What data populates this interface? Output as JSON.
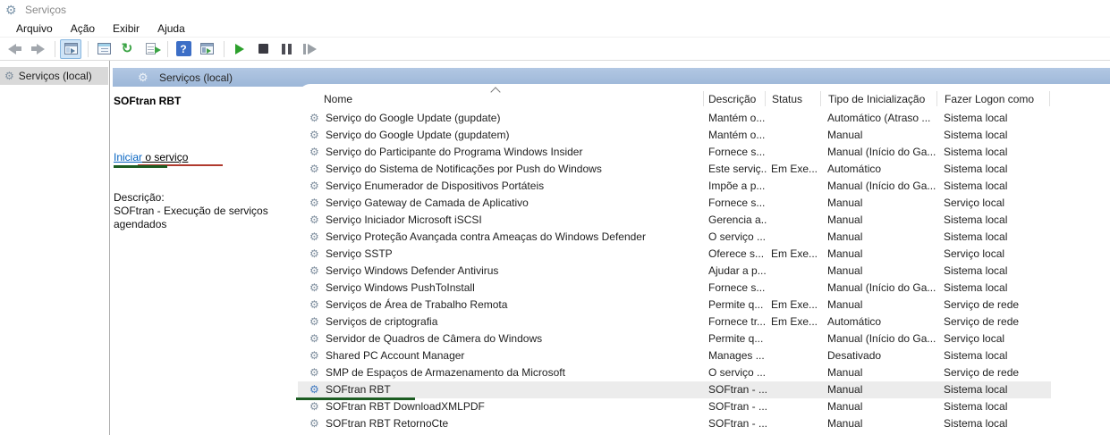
{
  "window": {
    "title": "Serviços",
    "app_icon": "services-gear-icon"
  },
  "menu": {
    "items": [
      {
        "label": "Arquivo"
      },
      {
        "label": "Ação"
      },
      {
        "label": "Exibir"
      },
      {
        "label": "Ajuda"
      }
    ]
  },
  "toolbar": {
    "icons": [
      "back-icon",
      "forward-icon",
      "show-console-tree-icon",
      "properties-icon",
      "refresh-icon",
      "export-list-icon",
      "help-icon",
      "extended-view-icon",
      "start-service-icon",
      "stop-service-icon",
      "pause-service-icon",
      "restart-service-icon"
    ],
    "active_toggle": "show-console-tree-icon",
    "accent_colors": {
      "play_green": "#2ca02c",
      "help_blue": "#3c6ec6",
      "refresh_green": "#3aa344"
    }
  },
  "tree": {
    "root_label": "Serviços (local)"
  },
  "content": {
    "header_label": "Serviços (local)",
    "detail_panel": {
      "service_name": "SOFtran RBT",
      "action_link_part1": "Iniciar",
      "action_link_part2": " o serviço",
      "description_label": "Descrição:",
      "description_text": "SOFtran - Execução de serviços agendados"
    },
    "annotations": {
      "link_green_underline": "#1c5c22",
      "link_red_underline": "#b03a2e",
      "selected_row_green_underline": "#1c5c22"
    },
    "table": {
      "columns": [
        "Nome",
        "Descrição",
        "Status",
        "Tipo de Inicialização",
        "Fazer Logon como"
      ],
      "sort": {
        "column": "Nome",
        "direction": "asc"
      },
      "rows": [
        {
          "name": "Serviço do Google Update (gupdate)",
          "desc": "Mantém o...",
          "status": "",
          "type": "Automático (Atraso ...",
          "logon": "Sistema local",
          "selected": false
        },
        {
          "name": "Serviço do Google Update (gupdatem)",
          "desc": "Mantém o...",
          "status": "",
          "type": "Manual",
          "logon": "Sistema local",
          "selected": false
        },
        {
          "name": "Serviço do Participante do Programa Windows Insider",
          "desc": "Fornece s...",
          "status": "",
          "type": "Manual (Início do Ga...",
          "logon": "Sistema local",
          "selected": false
        },
        {
          "name": "Serviço do Sistema de Notificações por Push do Windows",
          "desc": "Este serviç...",
          "status": "Em Exe...",
          "type": "Automático",
          "logon": "Sistema local",
          "selected": false
        },
        {
          "name": "Serviço Enumerador de Dispositivos Portáteis",
          "desc": "Impõe a p...",
          "status": "",
          "type": "Manual (Início do Ga...",
          "logon": "Sistema local",
          "selected": false
        },
        {
          "name": "Serviço Gateway de Camada de Aplicativo",
          "desc": "Fornece s...",
          "status": "",
          "type": "Manual",
          "logon": "Serviço local",
          "selected": false
        },
        {
          "name": "Serviço Iniciador Microsoft iSCSI",
          "desc": "Gerencia a...",
          "status": "",
          "type": "Manual",
          "logon": "Sistema local",
          "selected": false
        },
        {
          "name": "Serviço Proteção Avançada contra Ameaças do Windows Defender",
          "desc": "O serviço ...",
          "status": "",
          "type": "Manual",
          "logon": "Sistema local",
          "selected": false
        },
        {
          "name": "Serviço SSTP",
          "desc": "Oferece s...",
          "status": "Em Exe...",
          "type": "Manual",
          "logon": "Serviço local",
          "selected": false
        },
        {
          "name": "Serviço Windows Defender Antivirus",
          "desc": "Ajudar a p...",
          "status": "",
          "type": "Manual",
          "logon": "Sistema local",
          "selected": false
        },
        {
          "name": "Serviço Windows PushToInstall",
          "desc": "Fornece s...",
          "status": "",
          "type": "Manual (Início do Ga...",
          "logon": "Sistema local",
          "selected": false
        },
        {
          "name": "Serviços de Área de Trabalho Remota",
          "desc": "Permite q...",
          "status": "Em Exe...",
          "type": "Manual",
          "logon": "Serviço de rede",
          "selected": false
        },
        {
          "name": "Serviços de criptografia",
          "desc": "Fornece tr...",
          "status": "Em Exe...",
          "type": "Automático",
          "logon": "Serviço de rede",
          "selected": false
        },
        {
          "name": "Servidor de Quadros de Câmera do Windows",
          "desc": "Permite q...",
          "status": "",
          "type": "Manual (Início do Ga...",
          "logon": "Serviço local",
          "selected": false
        },
        {
          "name": "Shared PC Account Manager",
          "desc": "Manages ...",
          "status": "",
          "type": "Desativado",
          "logon": "Sistema local",
          "selected": false
        },
        {
          "name": "SMP de Espaços de Armazenamento da Microsoft",
          "desc": "O serviço ...",
          "status": "",
          "type": "Manual",
          "logon": "Serviço de rede",
          "selected": false
        },
        {
          "name": "SOFtran RBT",
          "desc": "SOFtran - ...",
          "status": "",
          "type": "Manual",
          "logon": "Sistema local",
          "selected": true
        },
        {
          "name": "SOFtran RBT DownloadXMLPDF",
          "desc": "SOFtran - ...",
          "status": "",
          "type": "Manual",
          "logon": "Sistema local",
          "selected": false
        },
        {
          "name": "SOFtran RBT RetornoCte",
          "desc": "SOFtran - ...",
          "status": "",
          "type": "Manual",
          "logon": "Sistema local",
          "selected": false
        }
      ]
    }
  }
}
